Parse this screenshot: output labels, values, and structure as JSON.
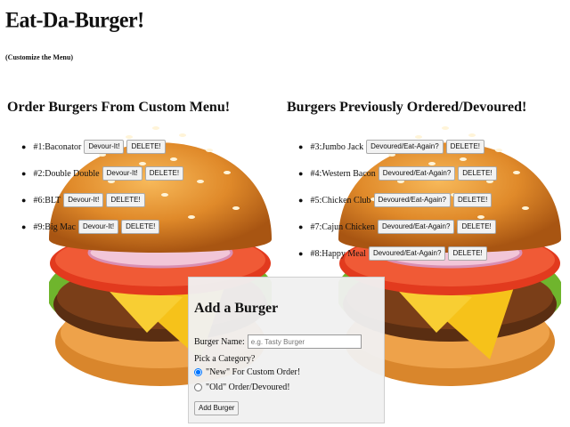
{
  "header": {
    "title": "Eat-Da-Burger!",
    "subtitle": "(Customize the Menu)"
  },
  "order_section": {
    "title": "Order Burgers From Custom Menu!",
    "devour_label": "Devour-It!",
    "delete_label": "DELETE!",
    "items": [
      {
        "text": "#1:Baconator"
      },
      {
        "text": "#2:Double Double"
      },
      {
        "text": "#6:BLT"
      },
      {
        "text": "#9:Big Mac"
      }
    ]
  },
  "devoured_section": {
    "title": "Burgers Previously Ordered/Devoured!",
    "eat_again_label": "Devoured/Eat-Again?",
    "delete_label": "DELETE!",
    "items": [
      {
        "text": "#3:Jumbo Jack"
      },
      {
        "text": "#4:Western Bacon"
      },
      {
        "text": "#5:Chicken Club"
      },
      {
        "text": "#7:Cajun Chicken"
      },
      {
        "text": "#8:Happy Meal"
      }
    ]
  },
  "add_form": {
    "title": "Add a Burger",
    "name_label": "Burger Name:",
    "name_placeholder": "e.g. Tasty Burger",
    "category_label": "Pick a Category?",
    "option_new": "\"New\" For Custom Order!",
    "option_old": "\"Old\" Order/Devoured!",
    "selected": "new",
    "submit_label": "Add Burger"
  }
}
